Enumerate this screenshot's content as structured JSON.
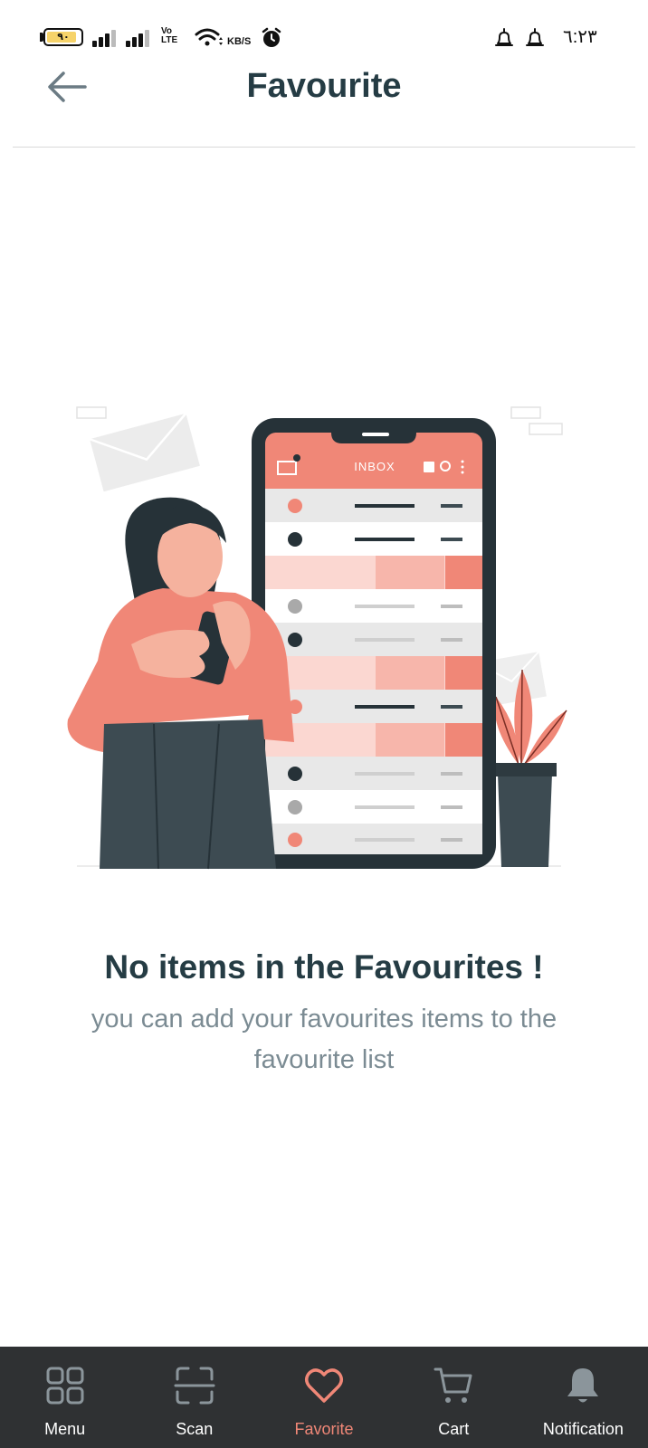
{
  "status_bar": {
    "battery_level": "٩٠",
    "volte_text": "Vo\nLTE",
    "speed_unit": "KB/S",
    "time": "٦:٢٣",
    "battery_fill_fraction": 0.9
  },
  "header": {
    "title": "Favourite",
    "back_icon": "arrow-left-icon"
  },
  "illustration": {
    "inbox_label": "INBOX"
  },
  "empty_state": {
    "title": "No items in the Favourites !",
    "subtitle": "you can add your favourites items to the favourite list"
  },
  "bottom_nav": {
    "items": [
      {
        "label": "Menu",
        "icon": "grid-icon"
      },
      {
        "label": "Scan",
        "icon": "scan-icon"
      },
      {
        "label": "Favorite",
        "icon": "heart-icon",
        "active": true
      },
      {
        "label": "Cart",
        "icon": "cart-icon"
      },
      {
        "label": "Notification",
        "icon": "bell-icon"
      }
    ]
  },
  "colors": {
    "accent": "#f08777",
    "nav_background": "#2f3133",
    "title_text": "#253c44",
    "subtitle_text": "#7b8b93"
  }
}
